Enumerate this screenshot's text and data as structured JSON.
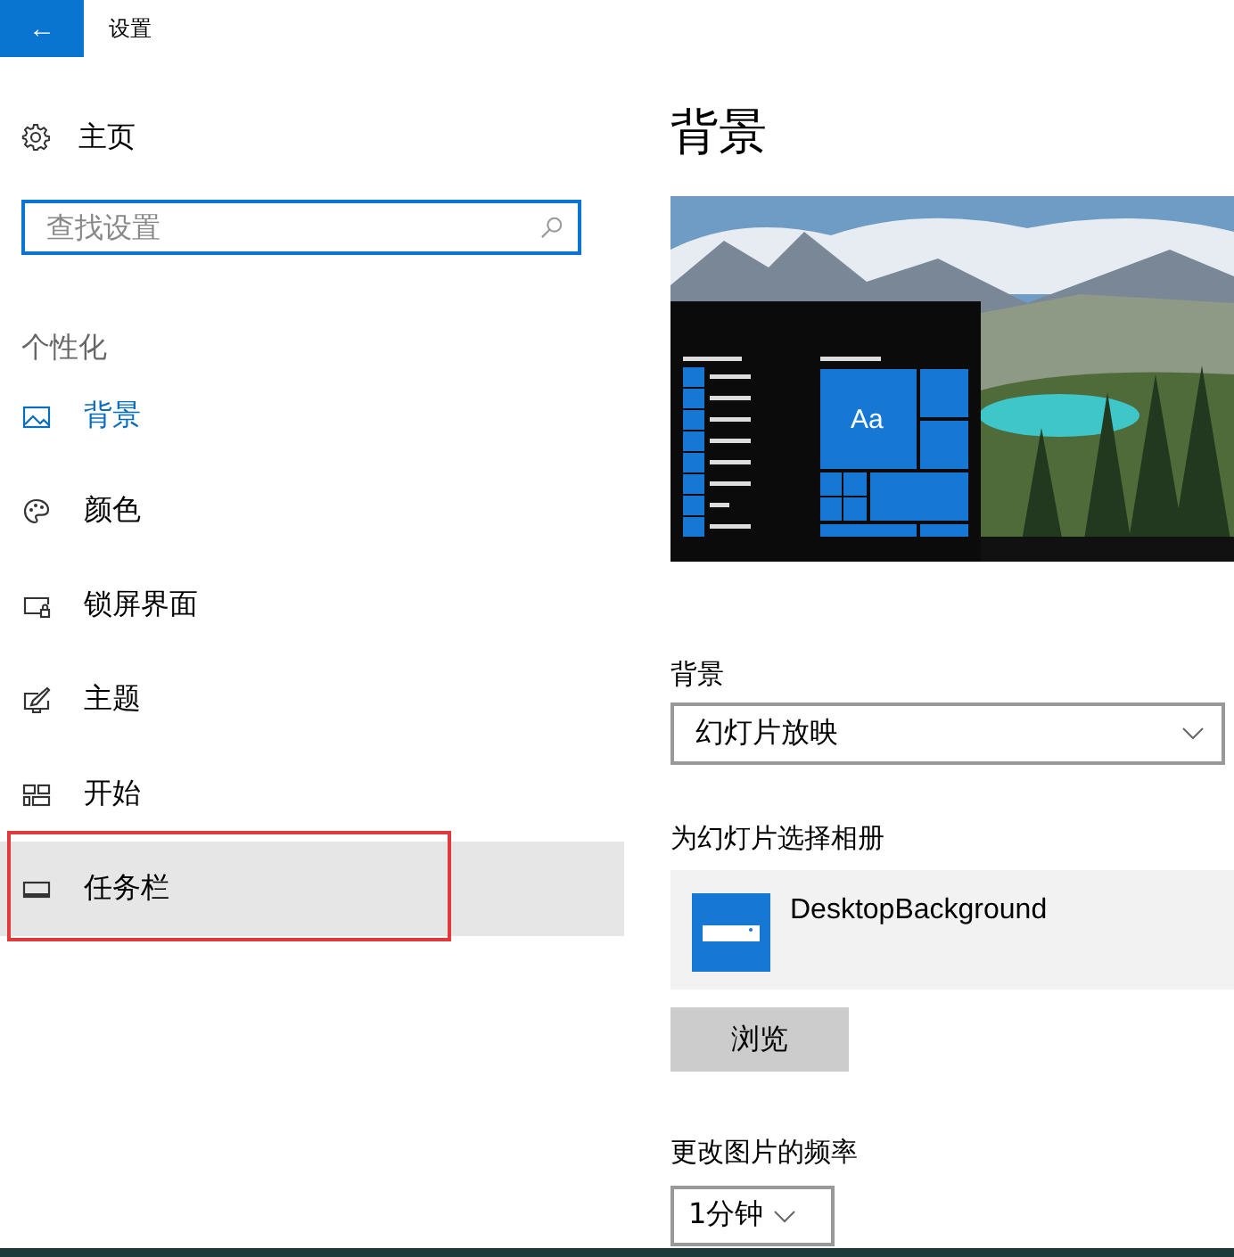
{
  "title_bar": {
    "back_icon": "←",
    "title": "设置"
  },
  "sidebar": {
    "home": "主页",
    "search": {
      "placeholder": "查找设置"
    },
    "section": "个性化",
    "items": [
      {
        "label": "背景",
        "selected": true,
        "hovered": false,
        "annotated": false
      },
      {
        "label": "颜色",
        "selected": false,
        "hovered": false,
        "annotated": false
      },
      {
        "label": "锁屏界面",
        "selected": false,
        "hovered": false,
        "annotated": false
      },
      {
        "label": "主题",
        "selected": false,
        "hovered": false,
        "annotated": false
      },
      {
        "label": "开始",
        "selected": false,
        "hovered": false,
        "annotated": false
      },
      {
        "label": "任务栏",
        "selected": false,
        "hovered": true,
        "annotated": true
      }
    ]
  },
  "content": {
    "heading": "背景",
    "preview": {
      "tile_label": "Aa"
    },
    "background": {
      "label": "背景",
      "value": "幻灯片放映"
    },
    "album": {
      "label": "为幻灯片选择相册",
      "name": "DesktopBackground"
    },
    "browse": "浏览",
    "frequency": {
      "label": "更改图片的频率",
      "value": "1分钟"
    }
  }
}
